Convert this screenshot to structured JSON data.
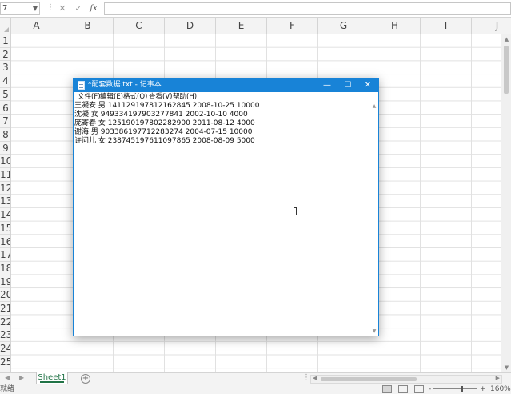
{
  "formula_bar": {
    "name_box_value": "7",
    "cancel_icon": "✕",
    "confirm_icon": "✓",
    "fx_label": "fx",
    "formula_value": ""
  },
  "grid": {
    "columns": [
      "A",
      "B",
      "C",
      "D",
      "E",
      "F",
      "G",
      "H",
      "I",
      "J"
    ],
    "rows": [
      "1",
      "2",
      "3",
      "4",
      "5",
      "6",
      "7",
      "8",
      "9",
      "10",
      "11",
      "12",
      "13",
      "14",
      "15",
      "16",
      "17",
      "18",
      "19",
      "20",
      "21",
      "22",
      "23",
      "24",
      "25"
    ]
  },
  "sheets": {
    "tabs": [
      "Sheet1"
    ],
    "add_symbol": "+"
  },
  "status_bar": {
    "ready_text": "就绪",
    "zoom_minus": "-",
    "zoom_plus": "+",
    "zoom_level": "160%"
  },
  "notepad": {
    "title": "*配套数据.txt - 记事本",
    "window_controls": {
      "minimize": "—",
      "maximize": "☐",
      "close": "✕"
    },
    "menu": [
      "文件(F)",
      "编辑(E)",
      "格式(O)",
      "查看(V)",
      "帮助(H)"
    ],
    "lines": [
      "王凝安 男 141129197812162845 2008-10-25 10000",
      "沈凝 女 949334197903277841 2002-10-10 4000",
      "庞寄春 女 125190197802282900 2011-08-12 4000",
      "谢海 男 903386197712283274 2004-07-15 10000",
      "许问儿 女 238745197611097865 2008-08-09 5000"
    ]
  },
  "colors": {
    "window_accent": "#1883d7",
    "sheet_tab_accent": "#217346"
  }
}
